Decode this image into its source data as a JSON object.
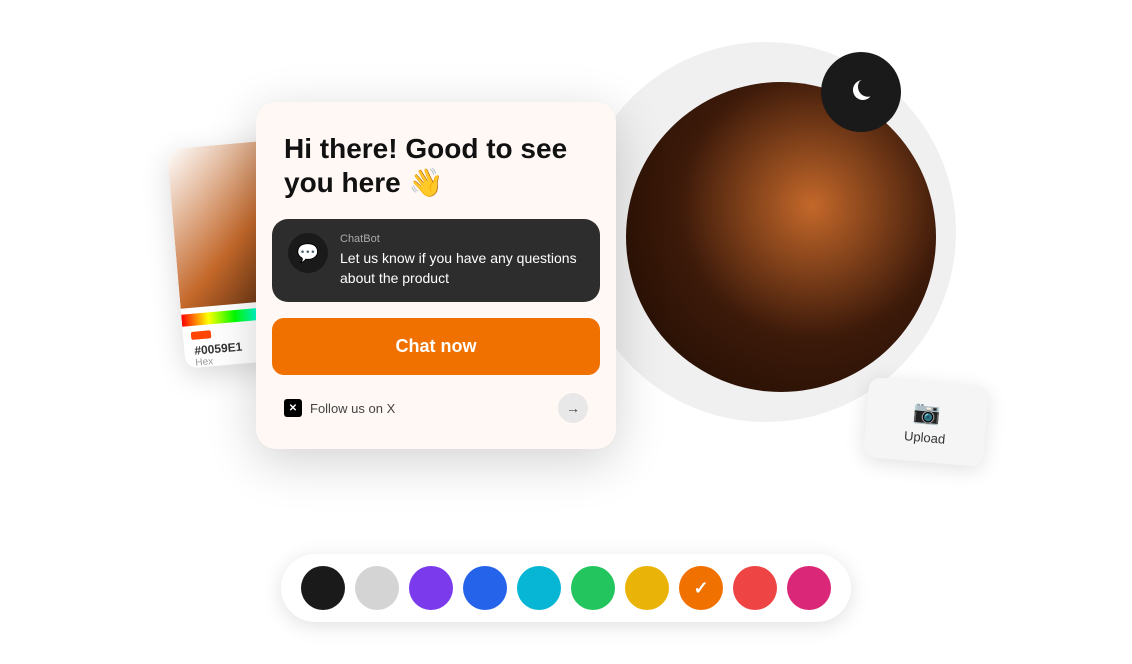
{
  "header": {
    "greeting": "Hi there! Good to see you here 👋"
  },
  "chat": {
    "sender": "ChatBot",
    "message": "Let us know if you have any questions about the product",
    "cta_label": "Chat now",
    "footer_text": "Follow us on X"
  },
  "color_picker": {
    "hex_value": "#0059E1",
    "hex_label": "Hex"
  },
  "upload": {
    "label": "Upload"
  },
  "palette": {
    "colors": [
      {
        "hex": "#1a1a1a",
        "label": "black",
        "selected": false
      },
      {
        "hex": "#d4d4d4",
        "label": "light-gray",
        "selected": false
      },
      {
        "hex": "#7c3aed",
        "label": "purple",
        "selected": false
      },
      {
        "hex": "#2563eb",
        "label": "blue",
        "selected": false
      },
      {
        "hex": "#06b6d4",
        "label": "cyan",
        "selected": false
      },
      {
        "hex": "#22c55e",
        "label": "green",
        "selected": false
      },
      {
        "hex": "#eab308",
        "label": "yellow",
        "selected": false
      },
      {
        "hex": "#f07000",
        "label": "orange",
        "selected": true
      },
      {
        "hex": "#ef4444",
        "label": "red",
        "selected": false
      },
      {
        "hex": "#db2777",
        "label": "pink",
        "selected": false
      }
    ]
  }
}
